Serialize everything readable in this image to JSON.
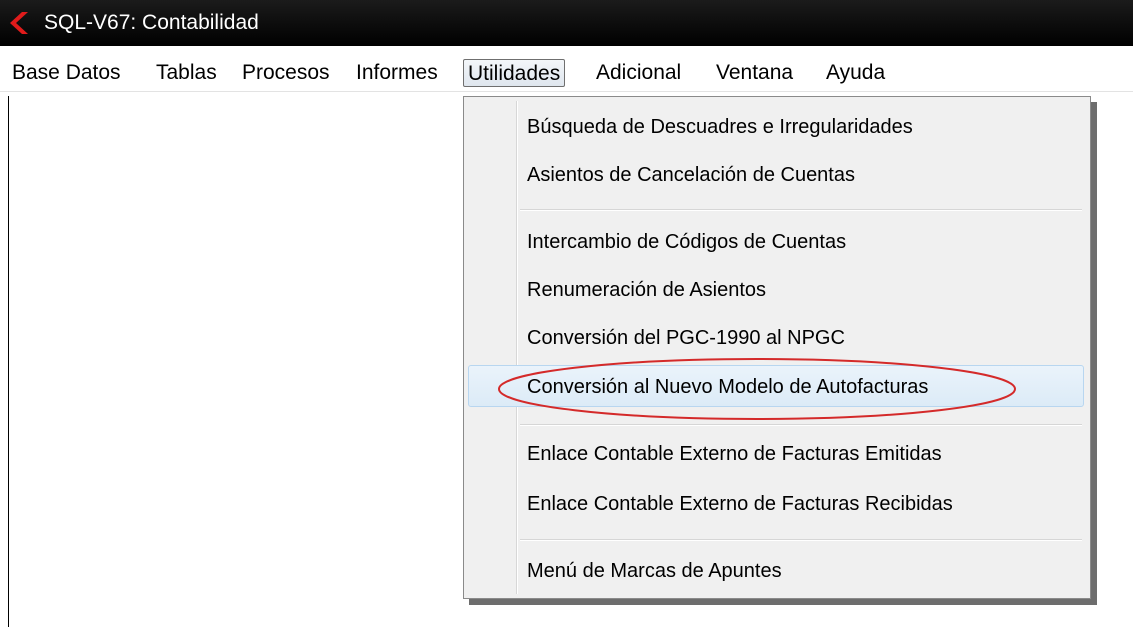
{
  "window": {
    "title": "SQL-V67: Contabilidad",
    "app_icon": "red-chevron-icon"
  },
  "menubar": {
    "items": [
      "Base Datos",
      "Tablas",
      "Procesos",
      "Informes",
      "Utilidades",
      "Adicional",
      "Ventana",
      "Ayuda"
    ],
    "active": "Utilidades"
  },
  "dropdown": {
    "items": [
      "Búsqueda de Descuadres e Irregularidades",
      "Asientos de Cancelación de Cuentas",
      "Intercambio de Códigos de Cuentas",
      "Renumeración de Asientos",
      "Conversión del PGC-1990 al NPGC",
      "Conversión al Nuevo Modelo de Autofacturas",
      "Enlace Contable Externo de Facturas Emitidas",
      "Enlace Contable Externo de Facturas Recibidas",
      "Menú de Marcas de Apuntes"
    ],
    "hovered": "Conversión al Nuevo Modelo de Autofacturas",
    "annotation_color": "#d42a2a"
  }
}
